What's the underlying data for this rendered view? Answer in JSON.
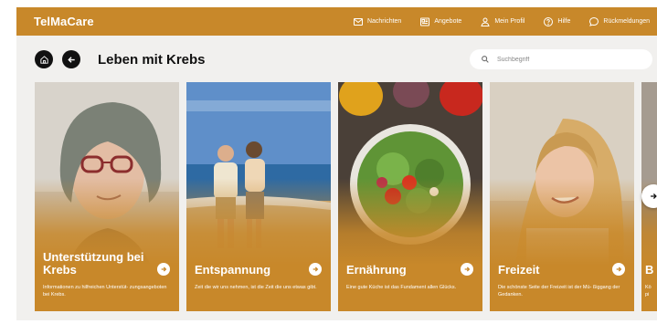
{
  "app": {
    "name": "TelMaCare",
    "accent": "#c8882a"
  },
  "nav": [
    {
      "label": "Nachrichten",
      "icon": "mail-icon"
    },
    {
      "label": "Angebote",
      "icon": "newspaper-icon"
    },
    {
      "label": "Mein Profil",
      "icon": "user-icon"
    },
    {
      "label": "Hilfe",
      "icon": "help-icon"
    },
    {
      "label": "Rückmeldungen",
      "icon": "chat-icon"
    }
  ],
  "page": {
    "title": "Leben mit Krebs"
  },
  "search": {
    "placeholder": "Suchbegriff"
  },
  "cards": [
    {
      "title": "Unterstützung bei Krebs",
      "description": "Informationen zu hilfreichen Unterstüt- zungsangeboten bei Krebs.",
      "image": "woman-with-headscarf"
    },
    {
      "title": "Entspannung",
      "description": "Zeit die wir uns nehmen, ist die Zeit die uns etwas gibt.",
      "image": "couple-on-beach"
    },
    {
      "title": "Ernährung",
      "description": "Eine gute Küche ist das Fundament allen Glücks.",
      "image": "salad-bowl"
    },
    {
      "title": "Freizeit",
      "description": "Die schönste Seite der Freizeit ist der Mü- ßiggang der Gedanken.",
      "image": "smiling-blonde-woman"
    },
    {
      "title": "B",
      "description": "Kö pi",
      "image": "partial-card"
    }
  ]
}
